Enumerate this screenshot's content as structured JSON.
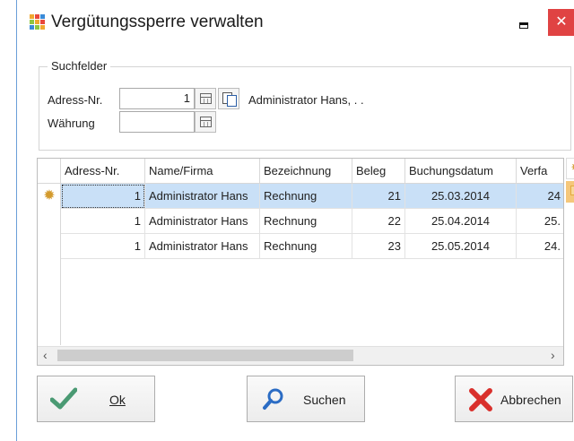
{
  "window": {
    "title": "Vergütungssperre verwalten",
    "minimize_glyph": "",
    "close_glyph": "✕"
  },
  "search": {
    "legend": "Suchfelder",
    "address_label": "Adress-Nr.",
    "address_value": "1",
    "address_name": "Administrator Hans, . .",
    "currency_label": "Währung",
    "currency_value": ""
  },
  "grid": {
    "columns": [
      "Adress-Nr.",
      "Name/Firma",
      "Bezeichnung",
      "Beleg",
      "Buchungsdatum",
      "Verfa"
    ],
    "rows": [
      {
        "adress": "1",
        "name": "Administrator Hans",
        "bezeichnung": "Rechnung",
        "beleg": "21",
        "datum": "25.03.2014",
        "verfall": "24",
        "selected": true
      },
      {
        "adress": "1",
        "name": "Administrator Hans",
        "bezeichnung": "Rechnung",
        "beleg": "22",
        "datum": "25.04.2014",
        "verfall": "25.",
        "selected": false
      },
      {
        "adress": "1",
        "name": "Administrator Hans",
        "bezeichnung": "Rechnung",
        "beleg": "23",
        "datum": "25.05.2014",
        "verfall": "24.",
        "selected": false
      }
    ]
  },
  "buttons": {
    "ok": "Ok",
    "search": "Suchen",
    "cancel": "Abbrechen"
  },
  "colors": {
    "accent": "#6a9fd8",
    "selection": "#c9e0f7",
    "close": "#e04343",
    "ok_check": "#4a9a73",
    "cancel_x": "#d9302c"
  }
}
